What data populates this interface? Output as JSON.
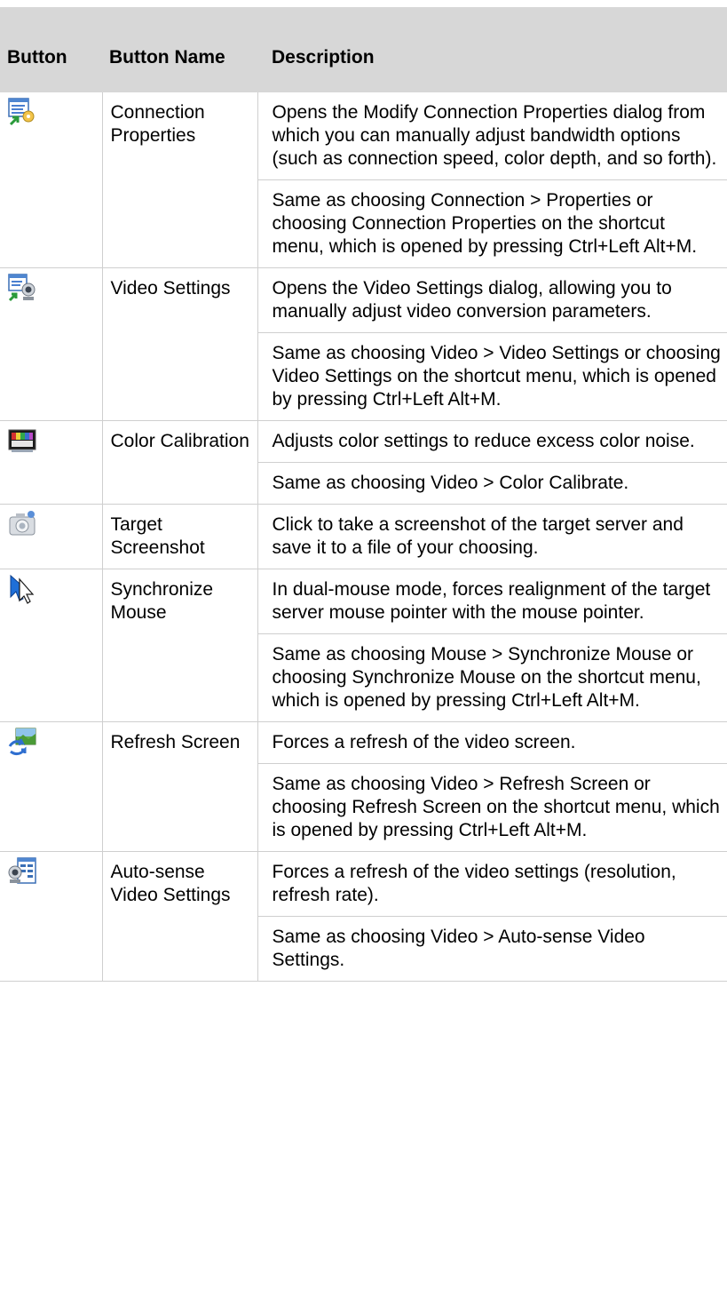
{
  "table": {
    "headers": {
      "button": "Button",
      "button_name": "Button Name",
      "description": "Description"
    },
    "rows": [
      {
        "icon": "connection-properties-icon",
        "name": "Connection Properties",
        "paragraphs": [
          "Opens the Modify Connection Properties dialog from which you can manually adjust bandwidth options (such as connection speed, color depth, and so forth).",
          "Same as choosing Connection > Properties or choosing Connection Properties on the shortcut menu, which is opened by pressing Ctrl+Left Alt+M."
        ]
      },
      {
        "icon": "video-settings-icon",
        "name": "Video Settings",
        "paragraphs": [
          "Opens the Video Settings dialog, allowing you to manually adjust video conversion parameters.",
          "Same as choosing Video > Video Settings or choosing Video Settings on the shortcut menu, which is opened by pressing Ctrl+Left Alt+M."
        ]
      },
      {
        "icon": "color-calibration-icon",
        "name": "Color Calibration",
        "paragraphs": [
          "Adjusts color settings to reduce excess color noise.",
          "Same as choosing Video > Color Calibrate."
        ]
      },
      {
        "icon": "target-screenshot-icon",
        "name": "Target Screenshot",
        "paragraphs": [
          "Click to take a screenshot of the target server and save it to a file of your choosing."
        ]
      },
      {
        "icon": "synchronize-mouse-icon",
        "name": "Synchronize Mouse",
        "paragraphs": [
          "In dual-mouse mode, forces realignment of the target server mouse pointer with the mouse pointer.",
          "Same as choosing Mouse > Synchronize Mouse or choosing Synchronize Mouse on the shortcut menu, which is opened by pressing Ctrl+Left Alt+M."
        ]
      },
      {
        "icon": "refresh-screen-icon",
        "name": "Refresh Screen",
        "paragraphs": [
          "Forces a refresh of the video screen.",
          "Same as choosing Video > Refresh Screen or choosing Refresh Screen on the shortcut menu, which is opened by pressing Ctrl+Left Alt+M."
        ]
      },
      {
        "icon": "auto-sense-video-settings-icon",
        "name": "Auto-sense Video Settings",
        "paragraphs": [
          "Forces a refresh of the video settings (resolution, refresh rate).",
          "Same as choosing Video > Auto-sense Video Settings."
        ]
      }
    ]
  }
}
